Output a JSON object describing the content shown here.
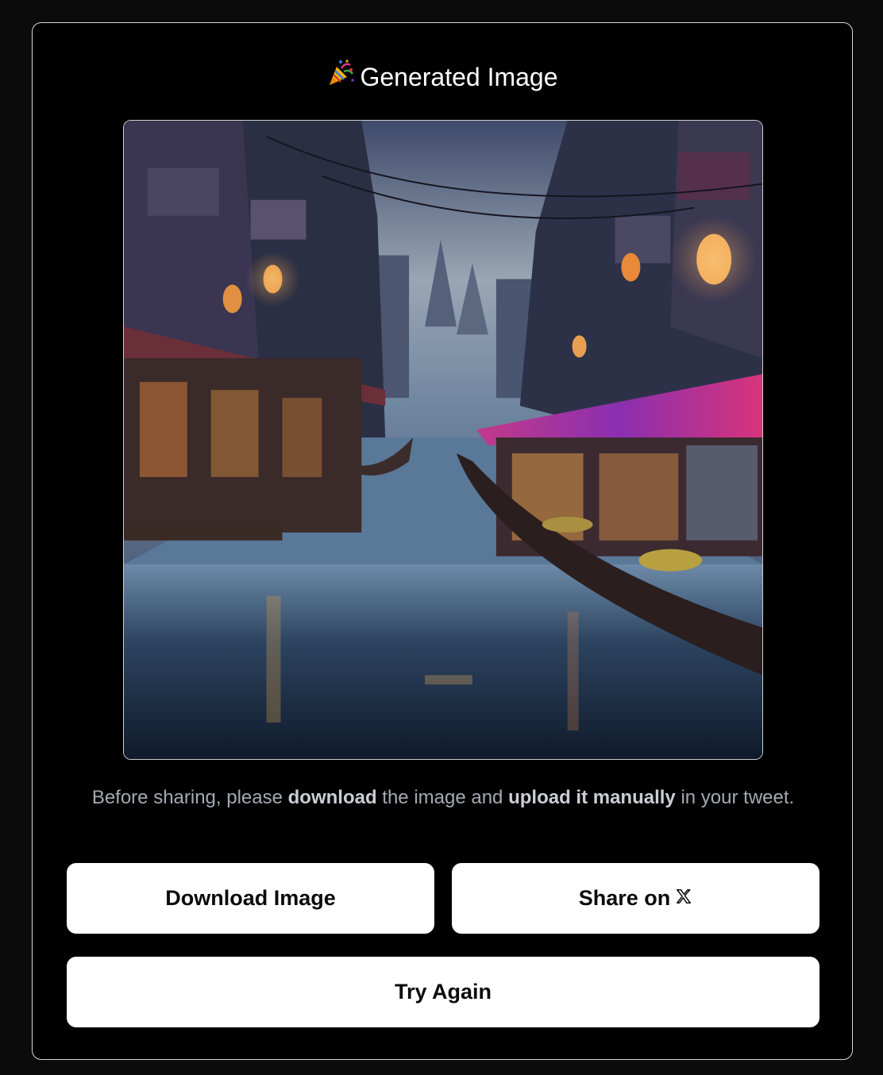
{
  "modal": {
    "title_emoji": "🎉",
    "title": "Generated Image",
    "image_description_icon": "party-popper-icon",
    "note": {
      "part1": "Before sharing, please ",
      "bold1": "download",
      "part2": " the image and ",
      "bold2": "upload it manually",
      "part3": " in your tweet."
    },
    "buttons": {
      "download": "Download Image",
      "share": "Share on",
      "retry": "Try Again"
    }
  },
  "colors": {
    "background": "#0b0b0b",
    "modal_bg": "#000000",
    "button_bg": "#ffffff",
    "note_text": "#a3aab3"
  }
}
